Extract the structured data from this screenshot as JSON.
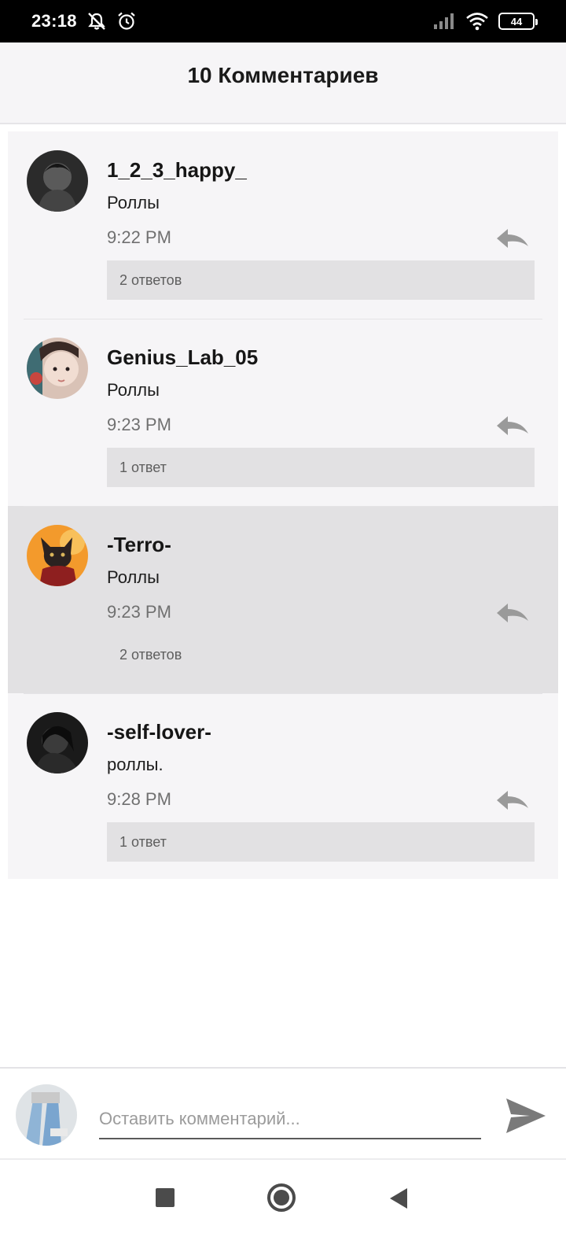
{
  "status_bar": {
    "time": "23:18",
    "icons": [
      "bell-off-icon",
      "alarm-icon",
      "signal-icon",
      "wifi-icon"
    ],
    "battery": "44"
  },
  "header": {
    "title": "10 Комментариев"
  },
  "comments": [
    {
      "username": "1_2_3_happy_",
      "text": "Роллы",
      "time": "9:22 PM",
      "replies": "2 ответов",
      "selected": false
    },
    {
      "username": "Genius_Lab_05",
      "text": "Роллы",
      "time": "9:23 PM",
      "replies": "1 ответ",
      "selected": false
    },
    {
      "username": "-Terro-",
      "text": "Роллы",
      "time": "9:23 PM",
      "replies": "2 ответов",
      "selected": true
    },
    {
      "username": "-self-lover-",
      "text": "роллы.",
      "time": "9:28 PM",
      "replies": "1 ответ",
      "selected": false
    }
  ],
  "composer": {
    "placeholder": "Оставить комментарий..."
  },
  "colors": {
    "status_bar": "#000000",
    "background": "#f6f5f7",
    "selected_row": "#e2e1e3",
    "secondary_text": "#707070"
  }
}
